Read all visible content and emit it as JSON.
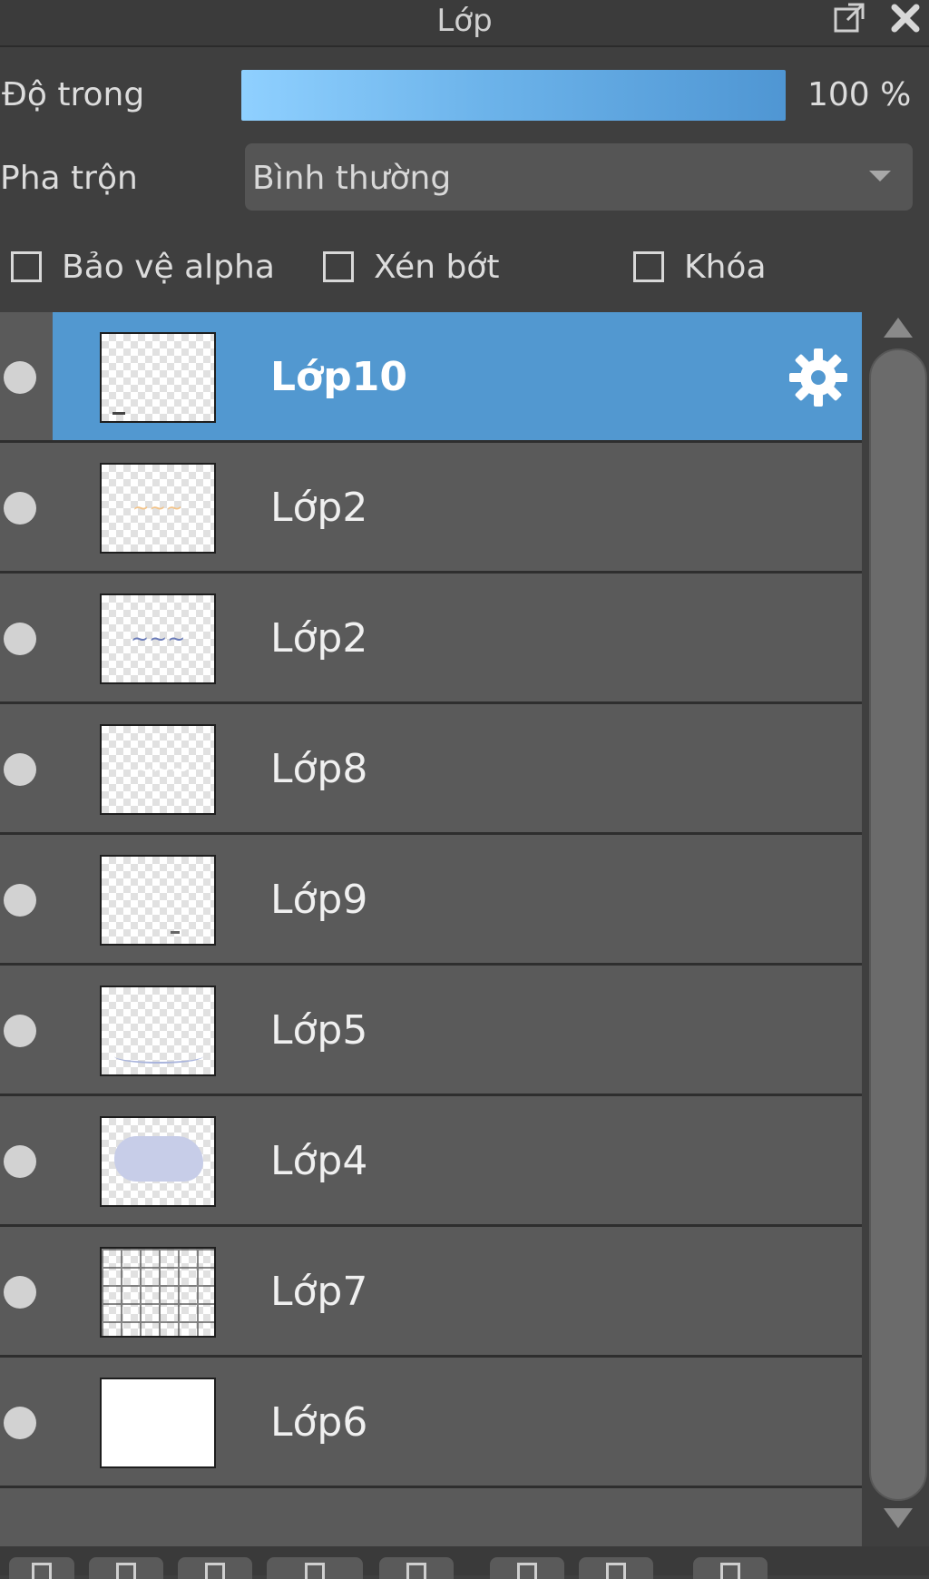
{
  "panel": {
    "title": "Lớp",
    "icons": [
      "popout-icon",
      "close-icon"
    ]
  },
  "opacity": {
    "label": "Độ trong",
    "value": 100,
    "display": "100 %",
    "fill_color_start": "#8fd0ff",
    "fill_color_end": "#4f96d3"
  },
  "blend": {
    "label": "Pha trộn",
    "selected": "Bình thường"
  },
  "options": {
    "protect_alpha": {
      "label": "Bảo vệ alpha",
      "checked": false
    },
    "clipping": {
      "label": "Xén bớt",
      "checked": false
    },
    "lock": {
      "label": "Khóa",
      "checked": false
    }
  },
  "layers": [
    {
      "name": "Lớp10",
      "selected": true,
      "visible": true,
      "thumb": "sketch-dot",
      "settings_icon": "gear-icon"
    },
    {
      "name": "Lớp2",
      "selected": false,
      "visible": true,
      "thumb": "orange-writing"
    },
    {
      "name": "Lớp2",
      "selected": false,
      "visible": true,
      "thumb": "blue-writing"
    },
    {
      "name": "Lớp8",
      "selected": false,
      "visible": true,
      "thumb": "white-writing"
    },
    {
      "name": "Lớp9",
      "selected": false,
      "visible": true,
      "thumb": "small-dot"
    },
    {
      "name": "Lớp5",
      "selected": false,
      "visible": true,
      "thumb": "curve-line"
    },
    {
      "name": "Lớp4",
      "selected": false,
      "visible": true,
      "thumb": "cloud"
    },
    {
      "name": "Lớp7",
      "selected": false,
      "visible": true,
      "thumb": "grid"
    },
    {
      "name": "Lớp6",
      "selected": false,
      "visible": true,
      "thumb": "white-fill"
    }
  ],
  "colors": {
    "selected_row": "#5298d0",
    "row": "#5a5a5a",
    "panel_bg": "#3f3f3f"
  }
}
